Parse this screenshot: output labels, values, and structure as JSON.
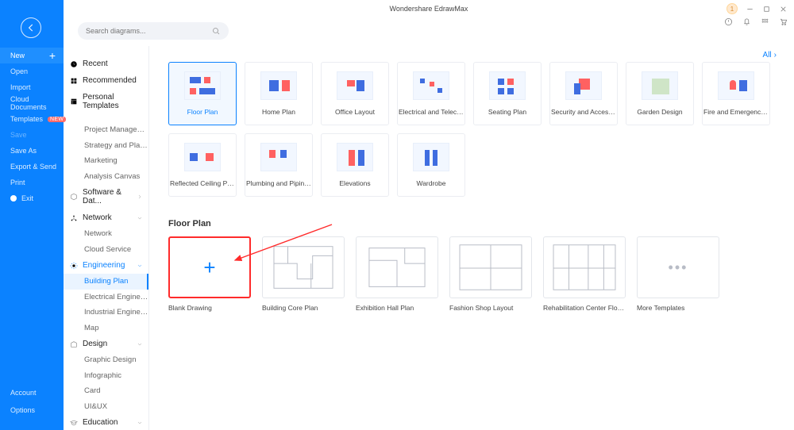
{
  "app_title": "Wondershare EdrawMax",
  "notification_count": "1",
  "search": {
    "placeholder": "Search diagrams..."
  },
  "all_link": "All",
  "primary": {
    "items": [
      {
        "label": "New",
        "active": true
      },
      {
        "label": "Open"
      },
      {
        "label": "Import"
      },
      {
        "label": "Cloud Documents"
      },
      {
        "label": "Templates",
        "badge": "NEW"
      },
      {
        "label": "Save",
        "disabled": true
      },
      {
        "label": "Save As"
      },
      {
        "label": "Export & Send"
      },
      {
        "label": "Print"
      },
      {
        "label": "Exit",
        "hasExitBullet": true
      }
    ],
    "bottom": [
      {
        "label": "Account"
      },
      {
        "label": "Options"
      }
    ]
  },
  "secondary": {
    "recent": "Recent",
    "recommended": "Recommended",
    "personal_templates": "Personal Templates",
    "groups": [
      {
        "label": "Project Management"
      },
      {
        "label": "Strategy and Planni..."
      },
      {
        "label": "Marketing"
      },
      {
        "label": "Analysis Canvas"
      }
    ],
    "software_data": "Software & Dat...",
    "network": "Network",
    "network_subs": [
      "Network",
      "Cloud Service"
    ],
    "engineering": "Engineering",
    "engineering_subs": [
      "Building Plan",
      "Electrical Engineering",
      "Industrial Engineeri...",
      "Map"
    ],
    "design": "Design",
    "design_subs": [
      "Graphic Design",
      "Infographic",
      "Card",
      "UI&UX"
    ],
    "education": "Education"
  },
  "categories_row1": [
    "Floor Plan",
    "Home Plan",
    "Office Layout",
    "Electrical and Telecom...",
    "Seating Plan",
    "Security and Access Pl...",
    "Garden Design",
    "Fire and Emergency Pl..."
  ],
  "categories_row2": [
    "Reflected Ceiling Plan",
    "Plumbing and Piping ...",
    "Elevations",
    "Wardrobe"
  ],
  "section_title": "Floor Plan",
  "templates": [
    "Blank Drawing",
    "Building Core Plan",
    "Exhibition Hall Plan",
    "Fashion Shop Layout",
    "Rehabilitation Center Floor Pl...",
    "More Templates"
  ]
}
